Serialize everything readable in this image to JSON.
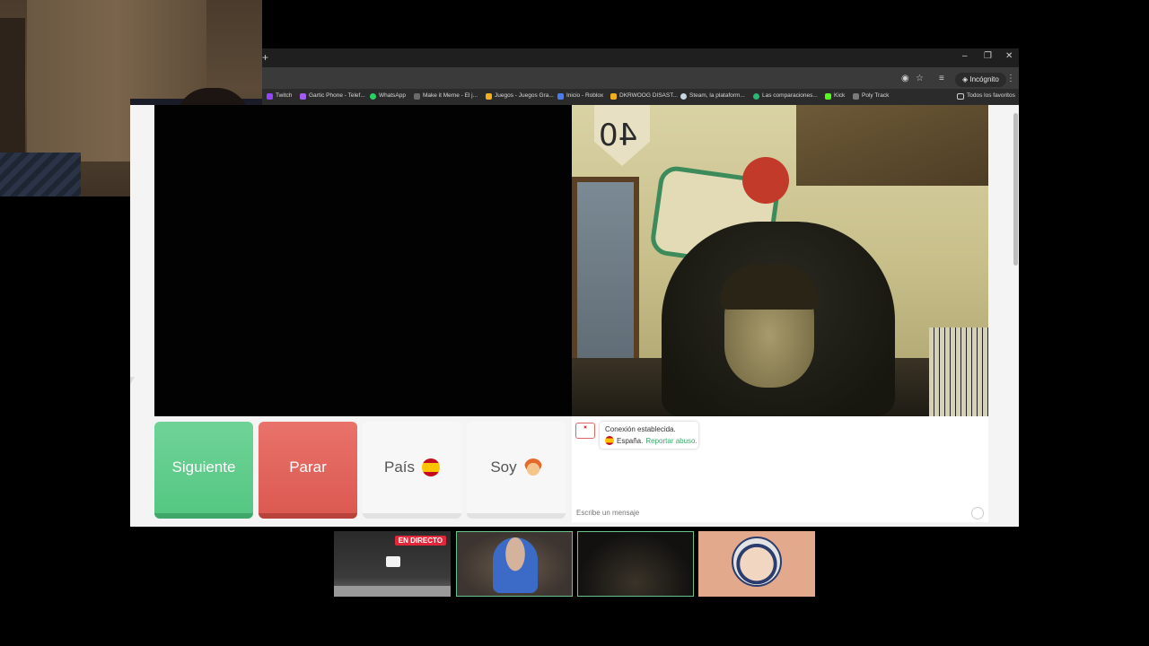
{
  "browser": {
    "new_tab_glyph": "+",
    "window_controls": {
      "minimize": "–",
      "restore": "❐",
      "close": "✕"
    },
    "incognito_label": "Incógnito",
    "bookmarks": [
      {
        "label": "Twitch",
        "color": "#9146ff"
      },
      {
        "label": "Gartic Phone - Telef...",
        "color": "#a25cf0"
      },
      {
        "label": "WhatsApp",
        "color": "#25d366"
      },
      {
        "label": "Make it Meme - El j...",
        "color": "#6a6a6a"
      },
      {
        "label": "Juegos - Juegos Gra...",
        "color": "#f2b01e"
      },
      {
        "label": "Inicio - Roblox",
        "color": "#4b7bec"
      },
      {
        "label": "DKRWOOG DISAST...",
        "color": "#f2b01e"
      },
      {
        "label": "Steam, la plataform...",
        "color": "#1b2838"
      },
      {
        "label": "Las comparaciones...",
        "color": "#2bb673"
      },
      {
        "label": "Kick",
        "color": "#53fc18"
      },
      {
        "label": "Poly Track",
        "color": "#7a7a7a"
      }
    ],
    "all_favorites_label": "Todos los favoritos"
  },
  "remote_video": {
    "badge_text": "40"
  },
  "controls": {
    "next_label": "Siguiente",
    "stop_label": "Parar",
    "country_label": "País",
    "soy_label": "Soy"
  },
  "chat": {
    "status_text": "Conexión establecida.",
    "country_text": "España.",
    "report_link": "Reportar abuso.",
    "input_placeholder": "Escribe un mensaje"
  },
  "thumbnails": {
    "live_badge": "EN DIRECTO"
  },
  "colors": {
    "next_green": "#55c783",
    "stop_red": "#dc5a52",
    "live_red": "#e0283a",
    "report_green": "#3aa86b"
  }
}
